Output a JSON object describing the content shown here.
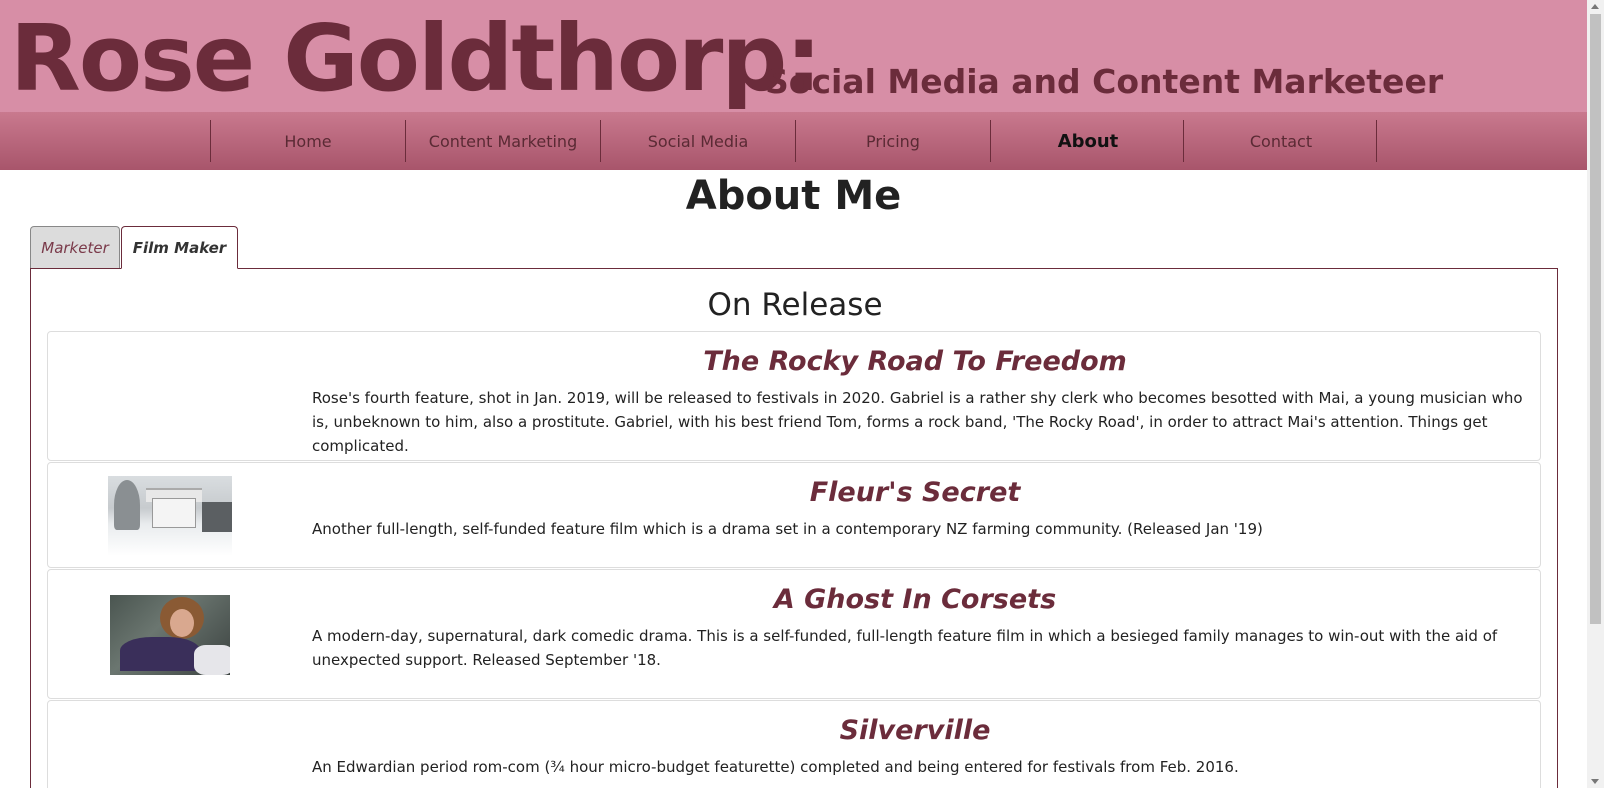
{
  "header": {
    "site_name": "Rose Goldthorp:",
    "tagline": "Social Media and Content Marketeer"
  },
  "nav": {
    "items": [
      {
        "label": "Home"
      },
      {
        "label": "Content Marketing"
      },
      {
        "label": "Social Media"
      },
      {
        "label": "Pricing"
      },
      {
        "label": "About",
        "active": true
      },
      {
        "label": "Contact"
      }
    ]
  },
  "main": {
    "page_title": "About Me",
    "tabs": [
      {
        "label": "Marketer",
        "active": false
      },
      {
        "label": "Film Maker",
        "active": true
      }
    ],
    "section_title": "On Release",
    "films": [
      {
        "title": "The Rocky Road To Freedom",
        "description": "Rose's fourth feature, shot in Jan. 2019, will be released to festivals in 2020. Gabriel is a rather shy clerk who becomes besotted with Mai, a young musician who is, unbeknown to him, also a prostitute. Gabriel, with his best friend Tom, forms a rock band, 'The Rocky Road', in order to attract Mai's attention. Things get complicated."
      },
      {
        "title": "Fleur's Secret",
        "description": "Another full-length, self-funded feature film which is a drama set in a contemporary NZ farming community. (Released Jan '19)"
      },
      {
        "title": "A Ghost In Corsets",
        "description": "A modern-day, supernatural, dark comedic drama. This is a self-funded, full-length feature film in which a besieged family manages to win-out with the aid of unexpected support. Released September '18."
      },
      {
        "title": "Silverville",
        "description": "An Edwardian period rom-com (¾ hour micro-budget featurette) completed and being entered for festivals from Feb. 2016."
      }
    ]
  },
  "colors": {
    "header_bg": "#d78ea6",
    "brand_dark": "#6b2c3b"
  }
}
